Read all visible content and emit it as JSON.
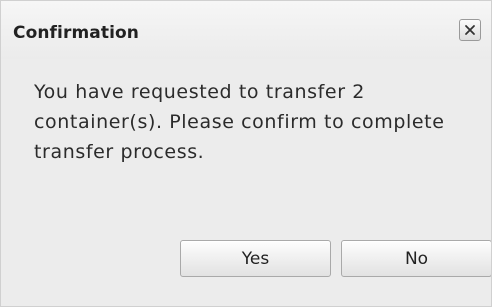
{
  "dialog": {
    "title": "Confirmation",
    "close_icon": "close-icon",
    "message": "You have requested to transfer 2 container(s). Please confirm to complete transfer process.",
    "buttons": {
      "yes_label": "Yes",
      "no_label": "No"
    }
  }
}
